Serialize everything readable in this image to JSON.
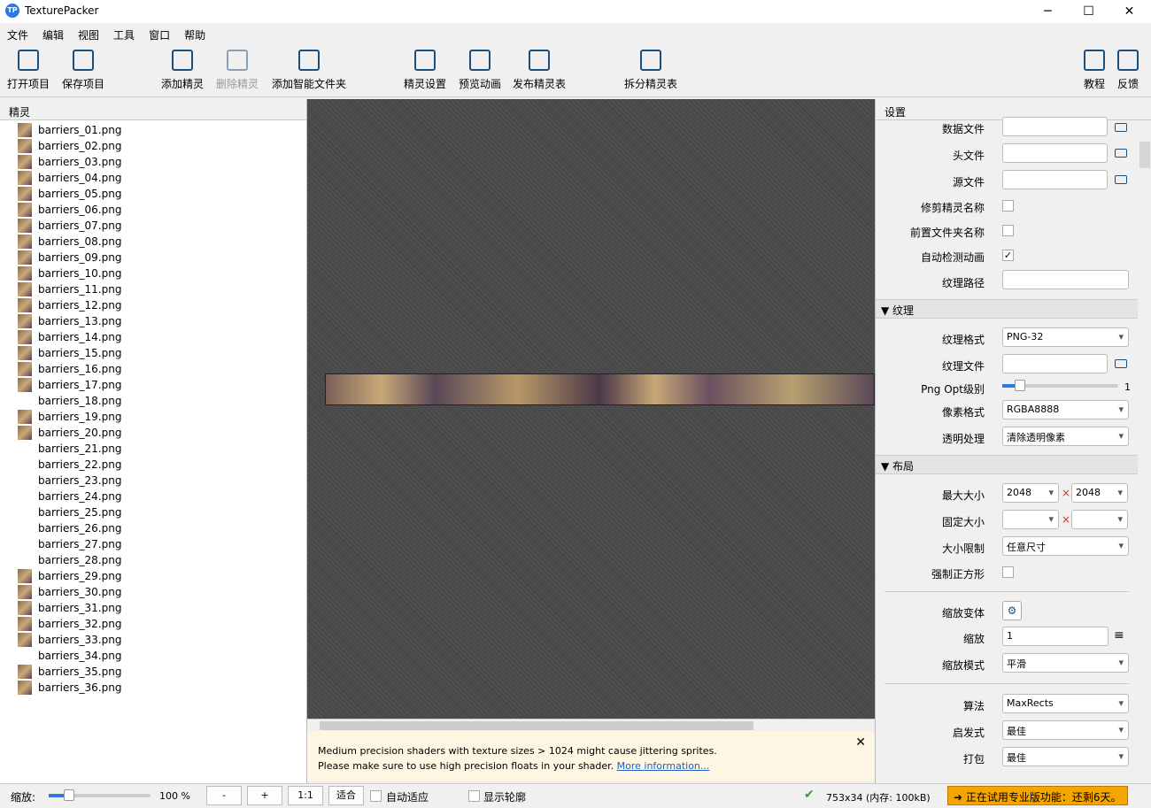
{
  "window": {
    "title": "TexturePacker",
    "logo": "TP",
    "minimize": "─",
    "maximize": "☐",
    "close": "✕"
  },
  "menu": [
    "文件",
    "编辑",
    "视图",
    "工具",
    "窗口",
    "帮助"
  ],
  "toolbar": {
    "open": "打开项目",
    "save": "保存项目",
    "add_sprite": "添加精灵",
    "remove_sprite": "删除精灵",
    "add_smart_folder": "添加智能文件夹",
    "sprite_settings": "精灵设置",
    "preview_anim": "预览动画",
    "publish": "发布精灵表",
    "split": "拆分精灵表",
    "tutorial": "教程",
    "feedback": "反馈"
  },
  "sprites": {
    "header": "精灵",
    "items": [
      {
        "name": "barriers_01.png",
        "thumb": true
      },
      {
        "name": "barriers_02.png",
        "thumb": true
      },
      {
        "name": "barriers_03.png",
        "thumb": true
      },
      {
        "name": "barriers_04.png",
        "thumb": true
      },
      {
        "name": "barriers_05.png",
        "thumb": true
      },
      {
        "name": "barriers_06.png",
        "thumb": true
      },
      {
        "name": "barriers_07.png",
        "thumb": true
      },
      {
        "name": "barriers_08.png",
        "thumb": true
      },
      {
        "name": "barriers_09.png",
        "thumb": true
      },
      {
        "name": "barriers_10.png",
        "thumb": true
      },
      {
        "name": "barriers_11.png",
        "thumb": true
      },
      {
        "name": "barriers_12.png",
        "thumb": true
      },
      {
        "name": "barriers_13.png",
        "thumb": true
      },
      {
        "name": "barriers_14.png",
        "thumb": true
      },
      {
        "name": "barriers_15.png",
        "thumb": true
      },
      {
        "name": "barriers_16.png",
        "thumb": true
      },
      {
        "name": "barriers_17.png",
        "thumb": true
      },
      {
        "name": "barriers_18.png",
        "thumb": false
      },
      {
        "name": "barriers_19.png",
        "thumb": true
      },
      {
        "name": "barriers_20.png",
        "thumb": true
      },
      {
        "name": "barriers_21.png",
        "thumb": false
      },
      {
        "name": "barriers_22.png",
        "thumb": false
      },
      {
        "name": "barriers_23.png",
        "thumb": false
      },
      {
        "name": "barriers_24.png",
        "thumb": false
      },
      {
        "name": "barriers_25.png",
        "thumb": false
      },
      {
        "name": "barriers_26.png",
        "thumb": false
      },
      {
        "name": "barriers_27.png",
        "thumb": false
      },
      {
        "name": "barriers_28.png",
        "thumb": false
      },
      {
        "name": "barriers_29.png",
        "thumb": true
      },
      {
        "name": "barriers_30.png",
        "thumb": true
      },
      {
        "name": "barriers_31.png",
        "thumb": true
      },
      {
        "name": "barriers_32.png",
        "thumb": true
      },
      {
        "name": "barriers_33.png",
        "thumb": true
      },
      {
        "name": "barriers_34.png",
        "thumb": false
      },
      {
        "name": "barriers_35.png",
        "thumb": true
      },
      {
        "name": "barriers_36.png",
        "thumb": true
      }
    ]
  },
  "warning": {
    "line1": "Medium precision shaders with texture sizes > 1024 might cause jittering sprites.",
    "line2": "Please make sure to use high precision floats in your shader. ",
    "link": "More information...",
    "close": "✕"
  },
  "settings": {
    "header": "设置",
    "data_file": "数据文件",
    "header_file": "头文件",
    "source_file": "源文件",
    "trim_names": "修剪精灵名称",
    "prepend_folder": "前置文件夹名称",
    "auto_detect_anim": "自动检测动画",
    "auto_detect_checked": "✓",
    "texture_path": "纹理路径",
    "texture_section": "▼ 纹理",
    "texture_format": "纹理格式",
    "texture_format_value": "PNG-32",
    "texture_file": "纹理文件",
    "png_opt": "Png Opt级别",
    "png_opt_value": "1",
    "pixel_format": "像素格式",
    "pixel_format_value": "RGBA8888",
    "alpha": "透明处理",
    "alpha_value": "清除透明像素",
    "layout_section": "▼ 布局",
    "max_size": "最大大小",
    "max_w": "2048",
    "max_h": "2048",
    "times": "×",
    "fixed_size": "固定大小",
    "size_constraint": "大小限制",
    "size_constraint_value": "任意尺寸",
    "force_square": "强制正方形",
    "scale_variants": "缩放变体",
    "scale": "缩放",
    "scale_value": "1",
    "scale_mode": "缩放模式",
    "scale_mode_value": "平滑",
    "algorithm": "算法",
    "algorithm_value": "MaxRects",
    "heuristic": "启发式",
    "heuristic_value": "最佳",
    "pack": "打包",
    "pack_value": "最佳"
  },
  "bottom": {
    "zoom_label": "缩放:",
    "zoom_value": "100 %",
    "zoom_slider": 0.2,
    "minus": "-",
    "plus": "+",
    "one_to_one": "1:1",
    "fit": "适合",
    "auto_fit": "自动适应",
    "show_outline": "显示轮廓",
    "status": "753x34 (内存: 100kB)",
    "pro_notice": "正在试用专业版功能：还剩6天。"
  }
}
